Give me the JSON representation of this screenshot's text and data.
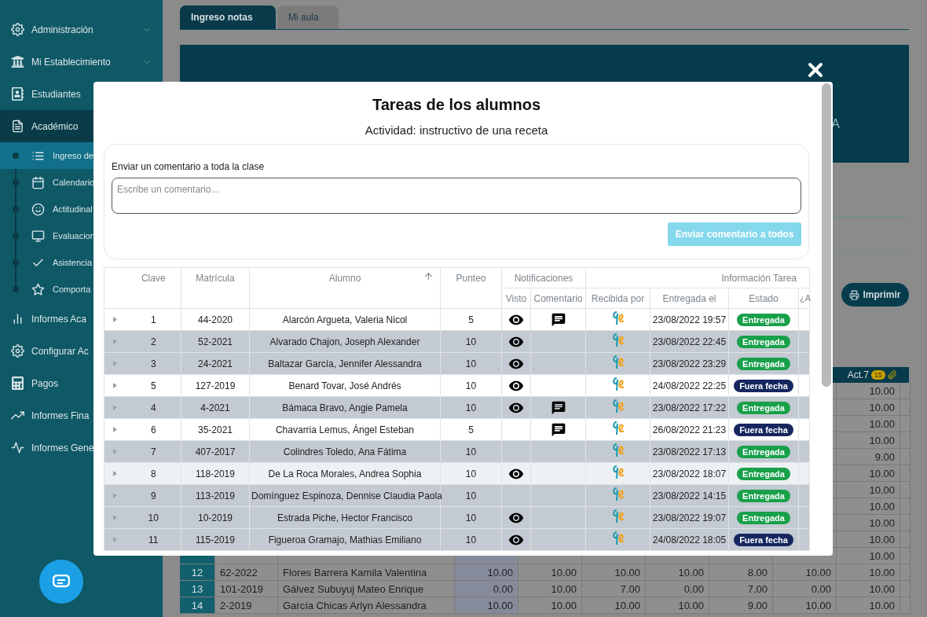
{
  "sidebar": {
    "items": [
      {
        "label": "Administración",
        "has_chevron": true,
        "active": false
      },
      {
        "label": "Mi Establecimiento",
        "has_chevron": true,
        "active": false
      },
      {
        "label": "Estudiantes",
        "has_chevron": false,
        "active": false
      },
      {
        "label": "Académico",
        "has_chevron": false,
        "active": true,
        "children": [
          {
            "label": "Ingreso de",
            "selected": true
          },
          {
            "label": "Calendario",
            "selected": false
          },
          {
            "label": "Actitudinal",
            "selected": false
          },
          {
            "label": "Evaluacion",
            "selected": false
          },
          {
            "label": "Asistencia",
            "selected": false
          },
          {
            "label": "Comporta",
            "selected": false
          }
        ]
      },
      {
        "label": "Informes Aca",
        "has_chevron": false,
        "active": false
      },
      {
        "label": "Configurar Ac",
        "has_chevron": false,
        "active": false
      },
      {
        "label": "Pagos",
        "has_chevron": false,
        "active": false
      },
      {
        "label": "Informes Fina",
        "has_chevron": false,
        "active": false
      },
      {
        "label": "Informes Gene",
        "has_chevron": false,
        "active": false
      }
    ]
  },
  "tabs": [
    {
      "label": "Ingreso notas",
      "selected": true
    },
    {
      "label": "Mi aula",
      "selected": false
    }
  ],
  "banner": {
    "title_fragment": "A"
  },
  "print_button": {
    "label": "Imprimir"
  },
  "grades_table": {
    "last_header": {
      "label": "Act.7",
      "badge": "15"
    },
    "covered_rows": [
      {
        "act_7": "10.00"
      },
      {
        "act_7": "10.00"
      },
      {
        "act_7": "10.00"
      },
      {
        "act_7": "10.00"
      },
      {
        "act_7": "9.00"
      },
      {
        "act_7": "10.00"
      },
      {
        "act_7": "10.00"
      },
      {
        "act_7": "10.00"
      },
      {
        "act_7": "10.00"
      },
      {
        "act_7": "10.00"
      },
      {
        "act_7": "10.00"
      }
    ],
    "rows": [
      {
        "number": "12",
        "matricula": "62-2022",
        "student": "Flores Barrera Kamila Valentina",
        "scores": [
          "10.00",
          "10.00",
          "10.00",
          "10.00",
          "8.00",
          "10.00",
          "10.00"
        ]
      },
      {
        "number": "13",
        "matricula": "101-2019",
        "student": "Gálvez Subuyuj Mateo Enrique",
        "scores": [
          "0.00",
          "10.00",
          "7.00",
          "0.00",
          "7.00",
          "0.00",
          "10.00"
        ]
      },
      {
        "number": "14",
        "matricula": "2-2019",
        "student": "García Chicas Arlyn Alessandra",
        "scores": [
          "10.00",
          "10.00",
          "10.00",
          "10.00",
          "9.00",
          "10.00",
          "10.00"
        ]
      }
    ]
  },
  "modal": {
    "title": "Tareas de los alumnos",
    "subtitle": "Actividad: instructivo de una receta",
    "comment_box": {
      "label": "Enviar un comentario a toda la clase",
      "placeholder": "Escribe un comentario...",
      "button": "Enviar comentario a todos",
      "button_disabled": true
    },
    "table": {
      "columns": {
        "clave": "Clave",
        "matricula": "Matrícula",
        "alumno": "Alumno",
        "punteo": "Punteo",
        "notificaciones": "Notificaciones",
        "visto": "Visto",
        "comentario": "Comentario",
        "informacion": "Información Tarea",
        "recibida": "Recibida por",
        "entregada": "Entregada el",
        "estado": "Estado",
        "cut": "¿A"
      },
      "sorted_ascending": true,
      "rows": [
        {
          "clave": "1",
          "matricula": "44-2020",
          "alumno": "Alarcón Argueta, Valeria Nicol",
          "punteo": "5",
          "visto": true,
          "comentario": true,
          "entregada": "23/08/2022 19:57",
          "estado": "Entregada",
          "late": false,
          "shaded": false,
          "hovered": false
        },
        {
          "clave": "2",
          "matricula": "52-2021",
          "alumno": "Alvarado Chajon, Joseph Alexander",
          "punteo": "10",
          "visto": true,
          "comentario": false,
          "entregada": "23/08/2022 22:45",
          "estado": "Entregada",
          "late": false,
          "shaded": true,
          "hovered": false
        },
        {
          "clave": "3",
          "matricula": "24-2021",
          "alumno": "Baltazar García, Jennifer Alessandra",
          "punteo": "10",
          "visto": true,
          "comentario": false,
          "entregada": "23/08/2022 23:29",
          "estado": "Entregada",
          "late": false,
          "shaded": true,
          "hovered": false
        },
        {
          "clave": "5",
          "matricula": "127-2019",
          "alumno": "Benard Tovar, José Andrés",
          "punteo": "10",
          "visto": true,
          "comentario": false,
          "entregada": "24/08/2022 22:25",
          "estado": "Fuera fecha",
          "late": true,
          "shaded": false,
          "hovered": false
        },
        {
          "clave": "4",
          "matricula": "4-2021",
          "alumno": "Bámaca Bravo, Angie Pamela",
          "punteo": "10",
          "visto": true,
          "comentario": true,
          "entregada": "23/08/2022 17:22",
          "estado": "Entregada",
          "late": false,
          "shaded": true,
          "hovered": false
        },
        {
          "clave": "6",
          "matricula": "35-2021",
          "alumno": "Chavarria Lemus, Ángel Esteban",
          "punteo": "5",
          "visto": false,
          "comentario": true,
          "entregada": "26/08/2022 21:23",
          "estado": "Fuera fecha",
          "late": true,
          "shaded": false,
          "hovered": false
        },
        {
          "clave": "7",
          "matricula": "407-2017",
          "alumno": "Colindres Toledo, Ana Fátima",
          "punteo": "10",
          "visto": false,
          "comentario": false,
          "entregada": "23/08/2022 17:13",
          "estado": "Entregada",
          "late": false,
          "shaded": true,
          "hovered": false
        },
        {
          "clave": "8",
          "matricula": "118-2019",
          "alumno": "De La Roca Morales, Andrea Sophia",
          "punteo": "10",
          "visto": true,
          "comentario": false,
          "entregada": "23/08/2022 18:07",
          "estado": "Entregada",
          "late": false,
          "shaded": false,
          "hovered": true
        },
        {
          "clave": "9",
          "matricula": "113-2019",
          "alumno": "Domínguez Espinoza, Dennise Claudia Paola",
          "punteo": "10",
          "visto": false,
          "comentario": false,
          "entregada": "23/08/2022 14:15",
          "estado": "Entregada",
          "late": false,
          "shaded": true,
          "hovered": false
        },
        {
          "clave": "10",
          "matricula": "10-2019",
          "alumno": "Estrada Piche, Hector Francisco",
          "punteo": "10",
          "visto": true,
          "comentario": false,
          "entregada": "23/08/2022 19:07",
          "estado": "Entregada",
          "late": false,
          "shaded": true,
          "hovered": false
        },
        {
          "clave": "11",
          "matricula": "115-2019",
          "alumno": "Figueroa Gramajo, Mathias Emiliano",
          "punteo": "10",
          "visto": true,
          "comentario": false,
          "entregada": "24/08/2022 18:05",
          "estado": "Fuera fecha",
          "late": true,
          "shaded": true,
          "hovered": false
        }
      ]
    }
  }
}
